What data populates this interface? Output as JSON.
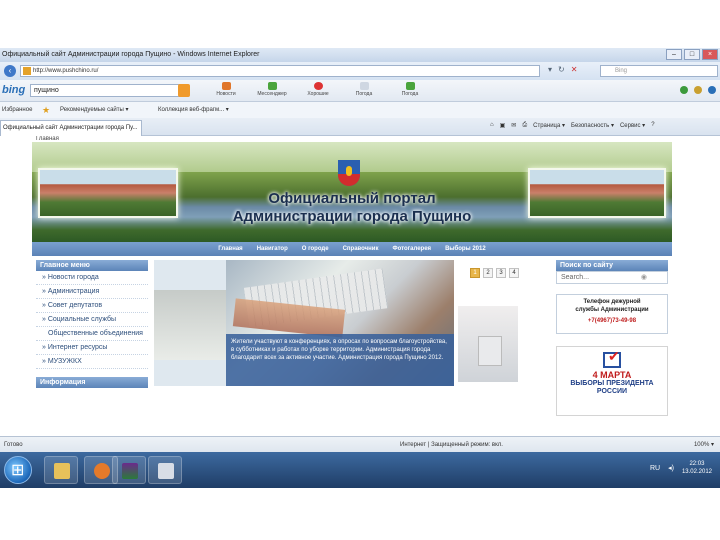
{
  "window": {
    "title": "Официальный сайт Администрации города Пущино - Windows Internet Explorer",
    "controls": [
      "–",
      "□",
      "×"
    ]
  },
  "address": {
    "url": "http://www.pushchino.ru/",
    "search_placeholder": "Bing"
  },
  "bing": {
    "logo": "bing",
    "query": "пущино",
    "tools": [
      "Новости",
      "Мессенджер",
      "Хорошие",
      "Погода",
      "Погода"
    ]
  },
  "favorites": {
    "label": "Избранное",
    "suggested": "Рекомендуемые сайты ▾",
    "gallery": "Коллекция веб-фрагм... ▾"
  },
  "tab": {
    "title": "Официальный сайт Администрации города Пу..."
  },
  "command_bar": {
    "page": "Страница ▾",
    "safety": "Безопасность ▾",
    "service": "Сервис ▾"
  },
  "site": {
    "breadcrumb": "Главная",
    "banner_title_1": "Официальный портал",
    "banner_title_2": "Администрации города Пущино",
    "nav": [
      "Главная",
      "Навигатор",
      "О городе",
      "Справочник",
      "Фотогалерея",
      "Выборы 2012"
    ],
    "main_menu_title": "Главное меню",
    "main_menu": [
      "» Новости города",
      "» Администрация",
      "» Совет депутатов",
      "» Социальные службы",
      "Общественные объединения",
      "» Интернет ресурсы",
      "» МУЗУЖКХ"
    ],
    "info_title": "Информация",
    "caption": "Жители участвуют в конференциях, в опросах по вопросам благоустройства, в субботниках и работах по уборке территории. Администрация города благодарит всех за активное участие. Администрация города Пущино 2012.",
    "pager": [
      "1",
      "2",
      "3",
      "4"
    ],
    "search_title": "Поиск по сайту",
    "search_placeholder": "Search...",
    "duty_1": "Телефон дежурной",
    "duty_2": "службы Администрации",
    "duty_phone": "+7(4967)73-49-98",
    "election_date": "4 МАРТА",
    "election_text_1": "ВЫБОРЫ ПРЕЗИДЕНТА",
    "election_text_2": "РОССИИ"
  },
  "status": {
    "left": "Готово",
    "zone": "Интернет | Защищенный режим: вкл.",
    "zoom": "100% ▾"
  },
  "taskbar": {
    "apps": [
      "explorer",
      "media-player",
      "ie",
      "winrar",
      "calculator"
    ],
    "lang": "RU",
    "time": "22:03",
    "date": "13.02.2012"
  },
  "colors": {
    "nav_blue": "#5b82b6",
    "caption_blue": "#39619b",
    "phone_red": "#c02020",
    "taskbar": "#1f3d66"
  }
}
